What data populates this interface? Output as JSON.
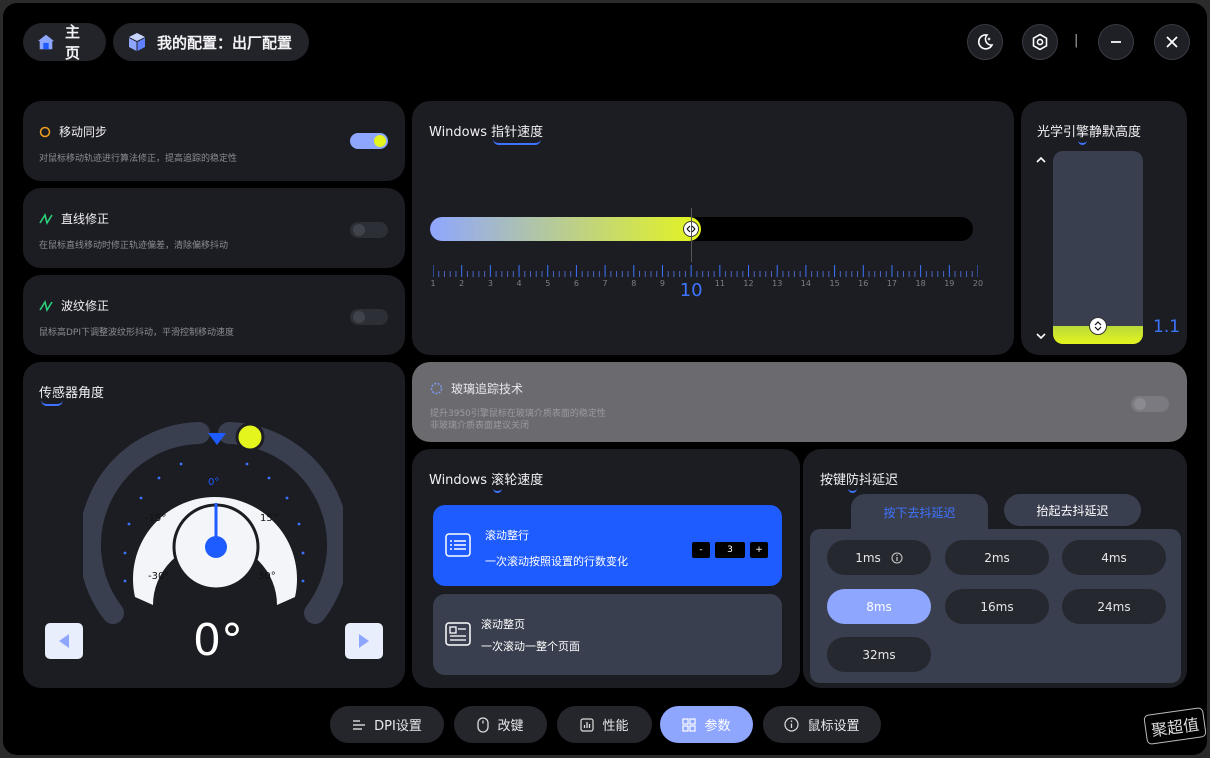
{
  "header": {
    "home_label": "主页",
    "config_label": "我的配置：出厂配置",
    "separator": "|"
  },
  "features": [
    {
      "title": "移动同步",
      "desc": "对鼠标移动轨迹进行算法修正，提高追踪的稳定性",
      "on": true
    },
    {
      "title": "直线修正",
      "desc": "在鼠标直线移动时修正轨迹偏差，清除偏移抖动",
      "on": false
    },
    {
      "title": "波纹修正",
      "desc": "鼠标高DPI下调整波纹形抖动，平滑控制移动速度",
      "on": false
    }
  ],
  "pointer_speed": {
    "title_prefix": "Windows ",
    "title_main": "指针速度",
    "value": 10,
    "value_label": "10",
    "min": 1,
    "max": 20,
    "labels": [
      "1",
      "2",
      "3",
      "4",
      "5",
      "6",
      "7",
      "8",
      "9",
      "",
      "11",
      "12",
      "13",
      "14",
      "15",
      "16",
      "17",
      "18",
      "19",
      "20"
    ]
  },
  "lod": {
    "title_prefix": "光学引",
    "title_main": "擎",
    "title_suffix": "静默高度",
    "value": 1.1,
    "value_label": "1.1"
  },
  "sensor_angle": {
    "title_main": "传感",
    "title_suffix": "器角度",
    "value_label": "0°",
    "scale": [
      "-30°",
      "-15°",
      "0°",
      "15°",
      "30°"
    ]
  },
  "glass_tracking": {
    "title": "玻璃追踪技术",
    "desc_line1": "提升3950引擎鼠标在玻璃介质表面的稳定性",
    "desc_line2": "非玻璃介质表面建议关闭",
    "on": false
  },
  "scroll_speed": {
    "title_prefix": "Windows ",
    "title_main": "滚",
    "title_suffix": "轮速度",
    "options": [
      {
        "title": "滚动整行",
        "desc": "一次滚动按照设置的行数变化"
      },
      {
        "title": "滚动整页",
        "desc": "一次滚动一整个页面"
      }
    ],
    "lines": "3",
    "minus": "-",
    "plus": "+"
  },
  "debounce": {
    "title_prefix": "按键",
    "title_main": "防",
    "title_suffix": "抖延迟",
    "tabs": [
      "按下去抖延迟",
      "抬起去抖延迟"
    ],
    "options": [
      "1ms",
      "2ms",
      "4ms",
      "8ms",
      "16ms",
      "24ms",
      "32ms"
    ],
    "selected": "8ms"
  },
  "bottom_nav": [
    "DPI设置",
    "改键",
    "性能",
    "参数",
    "鼠标设置"
  ],
  "watermark": "聚超值",
  "colors": {
    "accent_blue": "#1f5cff",
    "accent_soft": "#8fa6ff",
    "accent_yellow": "#e4f51e"
  }
}
